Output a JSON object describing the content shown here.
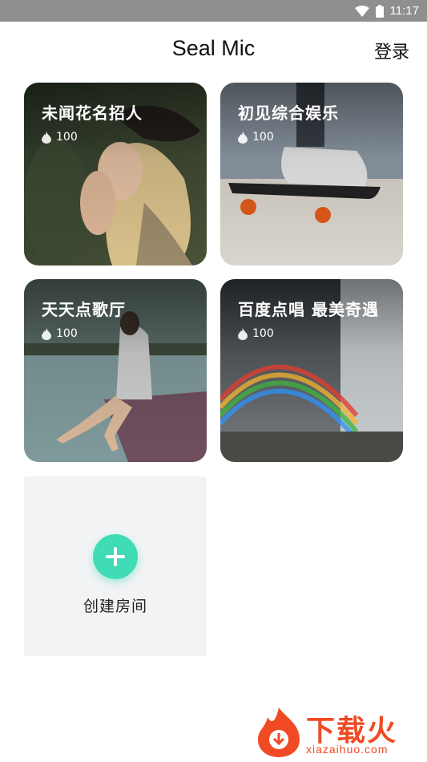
{
  "status_bar": {
    "time": "11:17",
    "icons": [
      "wifi-icon",
      "battery-icon"
    ]
  },
  "header": {
    "title": "Seal Mic",
    "login_label": "登录"
  },
  "rooms": [
    {
      "name": "未闻花名招人",
      "heat": "100",
      "image": "woman-in-hat-photo"
    },
    {
      "name": "初见综合娱乐",
      "heat": "100",
      "image": "skateboard-sneaker-photo"
    },
    {
      "name": "天天点歌厅",
      "heat": "100",
      "image": "girl-on-pier-photo"
    },
    {
      "name": "百度点唱 最美奇遇",
      "heat": "100",
      "image": "waterfall-rainbow-photo"
    }
  ],
  "create_room": {
    "label": "创建房间",
    "icon": "plus-icon",
    "accent": "#3fdcb5"
  },
  "watermark": {
    "brand": "下载火",
    "domain": "xiazaihuo.com"
  }
}
